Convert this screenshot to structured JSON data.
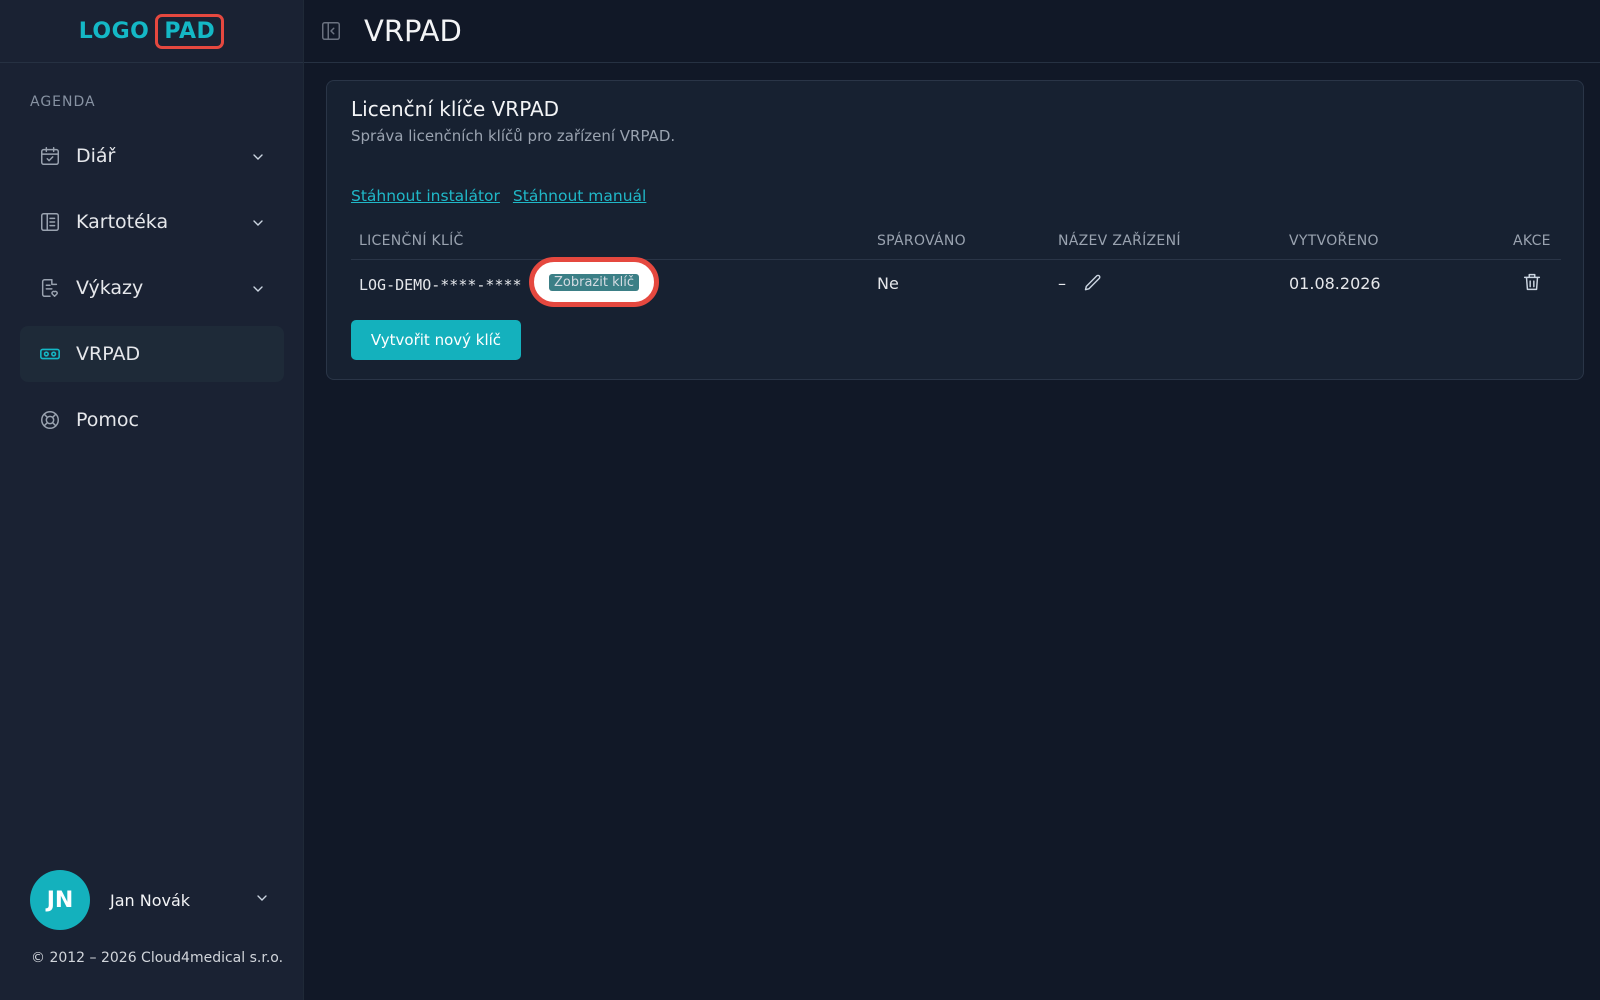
{
  "app": {
    "logo_left": "LOGO",
    "logo_right": "PAD",
    "brand_color": "#14b8c6",
    "highlight_color": "#e5483f"
  },
  "sidebar": {
    "section_label": "AGENDA",
    "items": [
      {
        "label": "Diář",
        "icon": "calendar-check-icon",
        "expandable": true
      },
      {
        "label": "Kartotéka",
        "icon": "card-index-icon",
        "expandable": true
      },
      {
        "label": "Výkazy",
        "icon": "report-icon",
        "expandable": true
      },
      {
        "label": "VRPAD",
        "icon": "vr-headset-icon",
        "expandable": false,
        "active": true
      },
      {
        "label": "Pomoc",
        "icon": "lifebuoy-icon",
        "expandable": false
      }
    ],
    "user": {
      "initials": "JN",
      "name": "Jan Novák"
    },
    "copyright": "© 2012 – 2026 Cloud4medical s.r.o."
  },
  "header": {
    "title": "VRPAD"
  },
  "card": {
    "title": "Licenční klíče VRPAD",
    "subtitle": "Správa licenčních klíčů pro zařízení VRPAD.",
    "links": {
      "installer": "Stáhnout instalátor",
      "manual": "Stáhnout manuál"
    },
    "table": {
      "headers": [
        "LICENČNÍ KLÍČ",
        "SPÁROVÁNO",
        "NÁZEV ZAŘÍZENÍ",
        "VYTVOŘENO",
        "AKCE"
      ],
      "rows": [
        {
          "key": "LOG-DEMO-****-****",
          "show_key": "Zobrazit klíč",
          "paired": "Ne",
          "device": "–",
          "created": "01.08.2026"
        }
      ]
    },
    "create_button": "Vytvořit nový klíč"
  }
}
